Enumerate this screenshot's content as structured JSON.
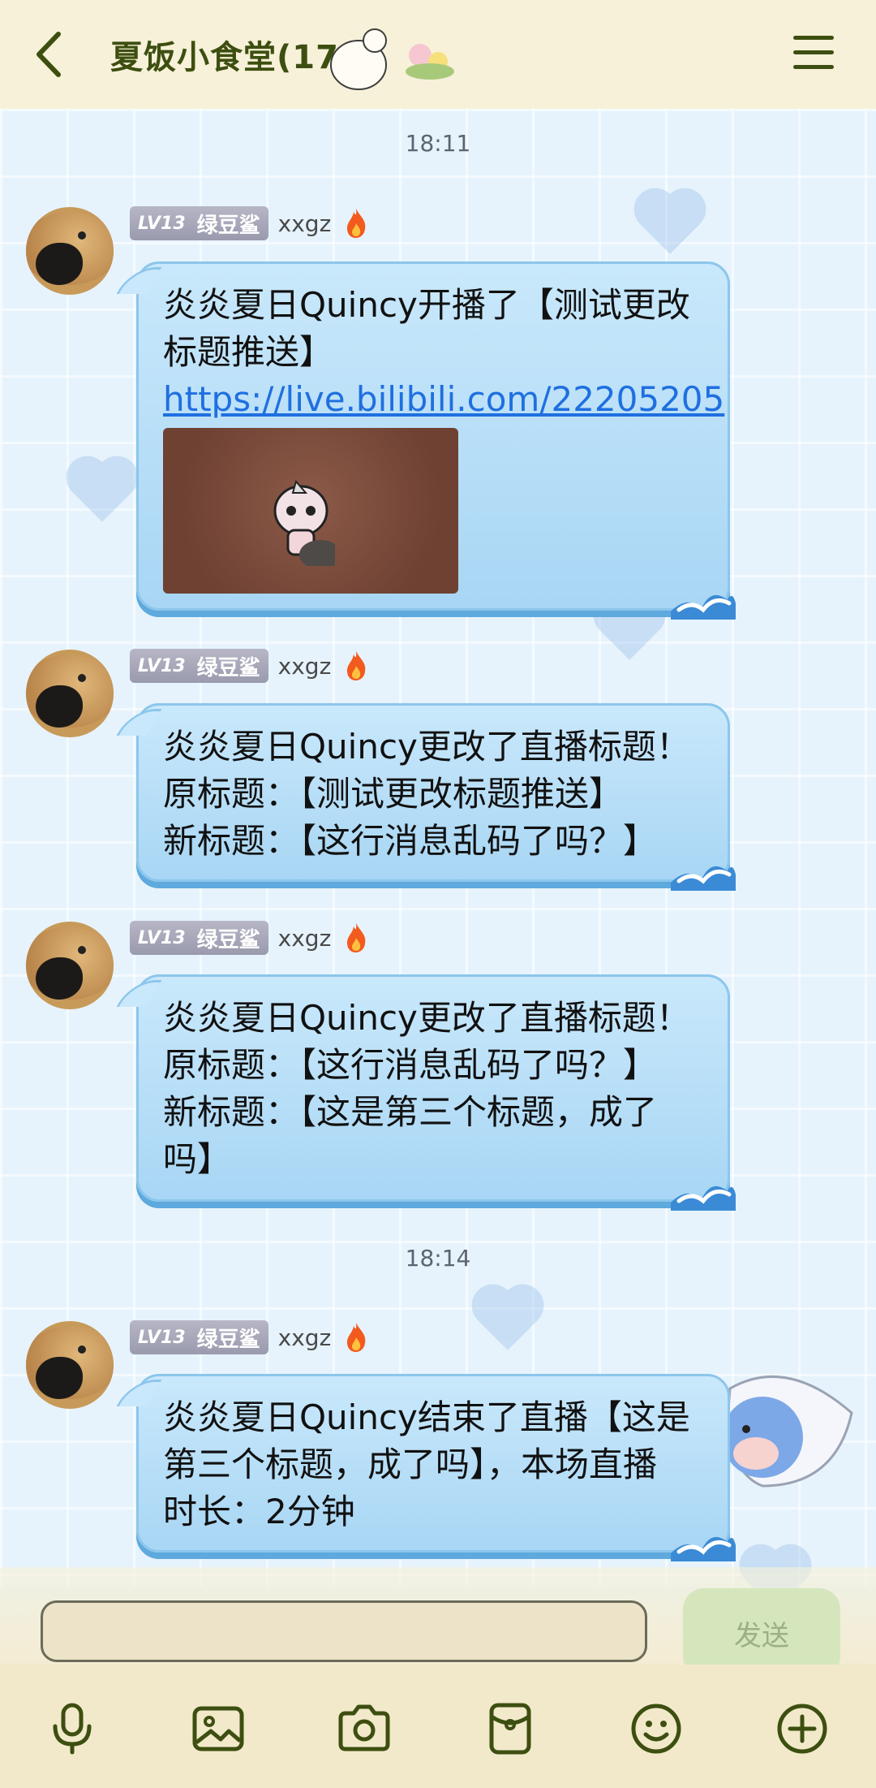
{
  "header": {
    "title": "夏饭小食堂(175)"
  },
  "messages": [
    {
      "time": "18:11",
      "level": "LV13",
      "title_tag": "绿豆鲨",
      "sender": "xxgz",
      "lines": [
        "炎炎夏日Quincy开播了【测试更改",
        "标题推送】"
      ],
      "link": "https://live.bilibili.com/22205205",
      "has_image": true
    },
    {
      "level": "LV13",
      "title_tag": "绿豆鲨",
      "sender": "xxgz",
      "lines": [
        "炎炎夏日Quincy更改了直播标题！",
        "原标题：【测试更改标题推送】",
        "新标题：【这行消息乱码了吗？】"
      ]
    },
    {
      "level": "LV13",
      "title_tag": "绿豆鲨",
      "sender": "xxgz",
      "lines": [
        "炎炎夏日Quincy更改了直播标题！",
        "原标题：【这行消息乱码了吗？】",
        "新标题：【这是第三个标题，成了",
        "吗】"
      ]
    },
    {
      "time": "18:14",
      "level": "LV13",
      "title_tag": "绿豆鲨",
      "sender": "xxgz",
      "lines": [
        "炎炎夏日Quincy结束了直播【这是",
        "第三个标题，成了吗】，本场直播",
        "时长：2分钟"
      ]
    }
  ],
  "input": {
    "value": "",
    "send_label": "发送"
  },
  "toolbar": {
    "icons": [
      "microphone-icon",
      "image-icon",
      "camera-icon",
      "red-packet-icon",
      "emoji-icon",
      "plus-icon"
    ]
  },
  "colors": {
    "header_bg": "#f7f1d9",
    "title": "#3d4f10",
    "bubble": "#b6def7",
    "link": "#1f6fe0",
    "send_button": "#d5e6bd"
  }
}
